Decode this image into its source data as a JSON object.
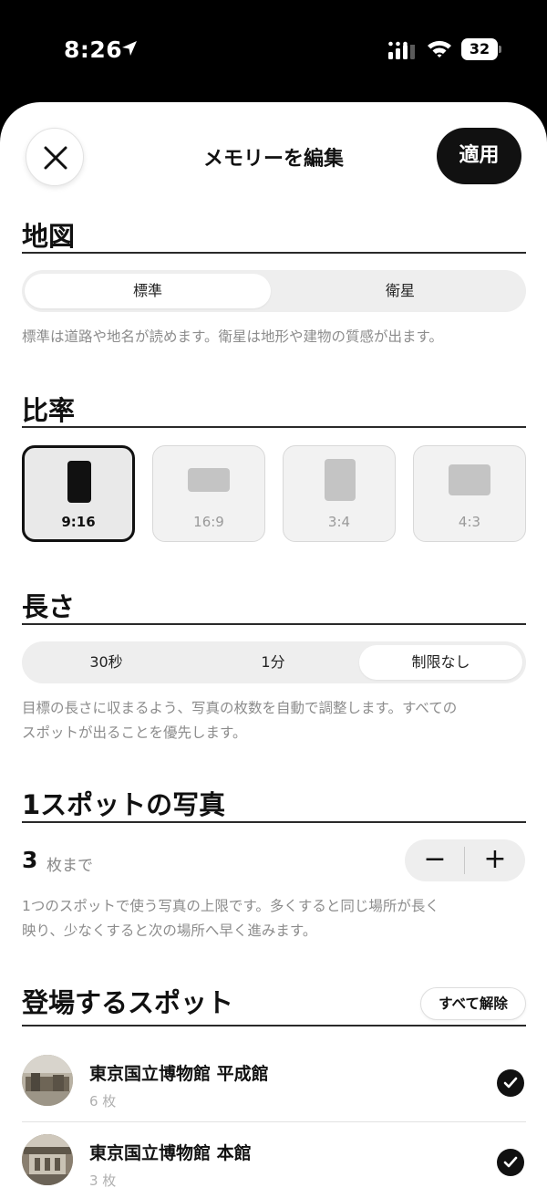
{
  "status_bar": {
    "time": "8:26",
    "battery_level": "32"
  },
  "header": {
    "title": "メモリーを編集",
    "apply_label": "適用"
  },
  "map_section": {
    "heading": "地図",
    "options": [
      "標準",
      "衛星"
    ],
    "selected": "標準",
    "description": "標準は道路や地名が読めます。衛星は地形や建物の質感が出ます。"
  },
  "ratio_section": {
    "heading": "比率",
    "options": [
      "9:16",
      "16:9",
      "3:4",
      "4:3"
    ],
    "selected": "9:16"
  },
  "length_section": {
    "heading": "長さ",
    "options": [
      "30秒",
      "1分",
      "制限なし"
    ],
    "selected": "制限なし",
    "description_line1": "目標の長さに収まるよう、写真の枚数を自動で調整します。すべての",
    "description_line2": "スポットが出ることを優先します。"
  },
  "photos_section": {
    "heading": "1スポットの写真",
    "value": "3",
    "unit": "枚まで",
    "minus_label": "−",
    "plus_label": "+",
    "description_line1": "1つのスポットで使う写真の上限です。多くすると同じ場所が長く",
    "description_line2": "映り、少なくすると次の場所へ早く進みます。"
  },
  "spots_section": {
    "heading": "登場するスポット",
    "clear_all_label": "すべて解除",
    "items": [
      {
        "name": "東京国立博物館 平成館",
        "count": "6 枚",
        "checked": true
      },
      {
        "name": "東京国立博物館 本館",
        "count": "3 枚",
        "checked": true
      }
    ]
  },
  "colors": {
    "accent": "#111111",
    "segment_bg": "#eeeeee",
    "secondary_text": "#8c8c8c",
    "background": "#ffffff"
  },
  "icons": {
    "close": "close-icon",
    "check": "check-icon",
    "location": "location-arrow-icon"
  }
}
